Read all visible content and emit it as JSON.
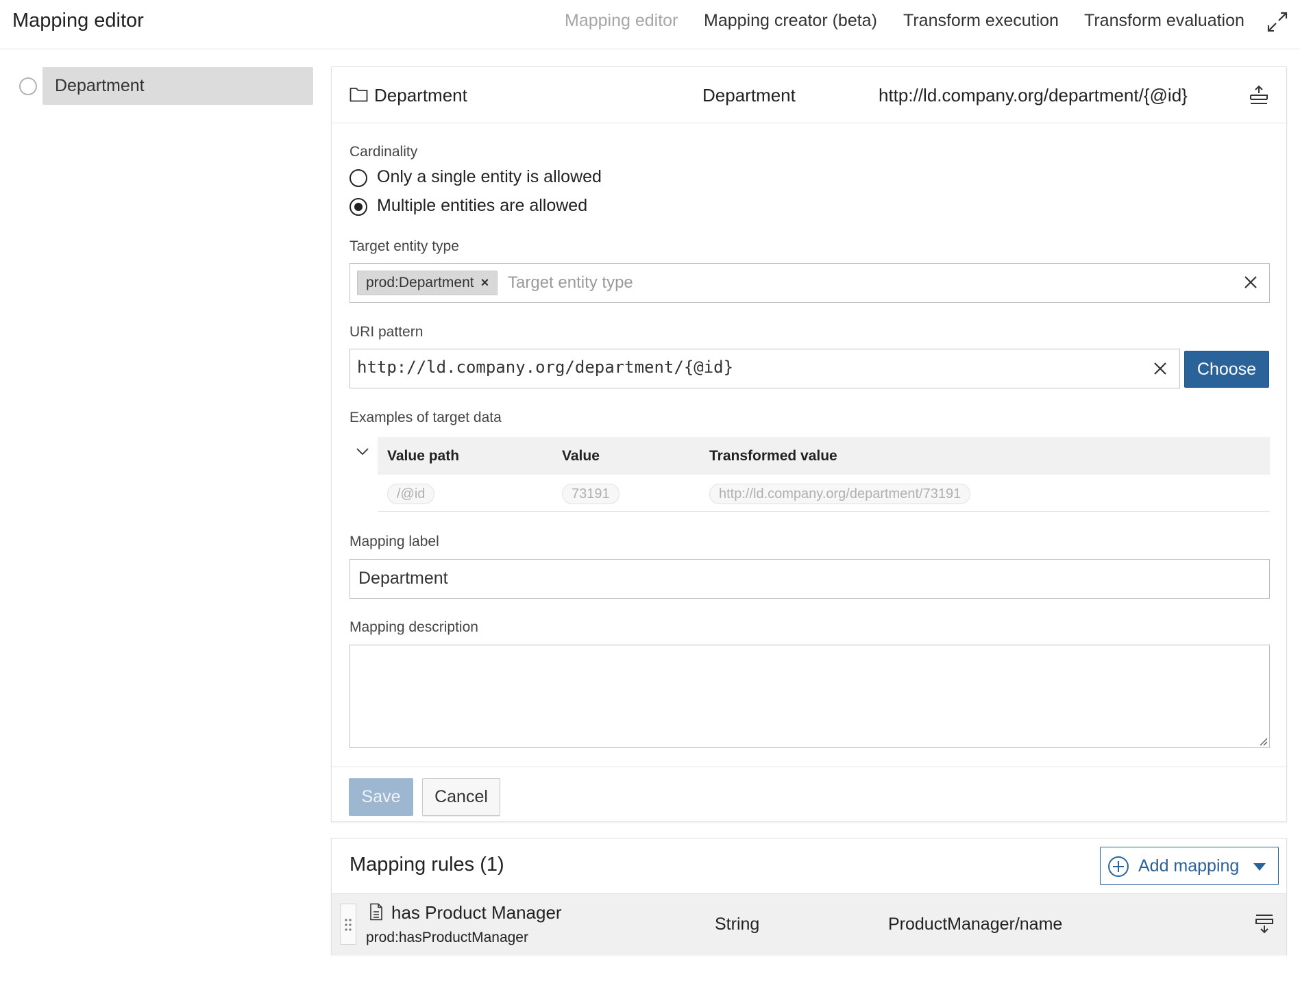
{
  "header": {
    "title": "Mapping editor",
    "tabs": [
      {
        "label": "Mapping editor",
        "active": true
      },
      {
        "label": "Mapping creator (beta)",
        "active": false
      },
      {
        "label": "Transform execution",
        "active": false
      },
      {
        "label": "Transform evaluation",
        "active": false
      }
    ]
  },
  "tree": {
    "items": [
      {
        "label": "Department"
      }
    ]
  },
  "rule_header": {
    "name": "Department",
    "type": "Department",
    "uri": "http://ld.company.org/department/{@id}"
  },
  "form": {
    "cardinality": {
      "label": "Cardinality",
      "options": [
        {
          "label": "Only a single entity is allowed",
          "selected": false
        },
        {
          "label": "Multiple entities are allowed",
          "selected": true
        }
      ]
    },
    "target_type": {
      "label": "Target entity type",
      "chips": [
        "prod:Department"
      ],
      "placeholder": "Target entity type"
    },
    "uri_pattern": {
      "label": "URI pattern",
      "value": "http://ld.company.org/department/{@id}",
      "choose_label": "Choose"
    },
    "examples": {
      "label": "Examples of target data",
      "columns": [
        "Value path",
        "Value",
        "Transformed value"
      ],
      "rows": [
        {
          "path": "/@id",
          "value": "73191",
          "transformed": "http://ld.company.org/department/73191"
        }
      ]
    },
    "mapping_label": {
      "label": "Mapping label",
      "value": "Department"
    },
    "mapping_description": {
      "label": "Mapping description",
      "value": ""
    },
    "save_label": "Save",
    "cancel_label": "Cancel"
  },
  "rules": {
    "title": "Mapping rules (1)",
    "add_label": "Add mapping",
    "items": [
      {
        "label": "has Product Manager",
        "property": "prod:hasProductManager",
        "type": "String",
        "source": "ProductManager/name"
      }
    ]
  },
  "colors": {
    "primary": "#2a6399",
    "primary_disabled": "#9db7d1",
    "selected_bg": "#dcdcdc",
    "table_head_bg": "#f1f1f1"
  },
  "icons": [
    "expand-icon",
    "folder-icon",
    "collapse-icon",
    "close-icon",
    "chevron-down-icon",
    "plus-circle-icon",
    "caret-down-icon",
    "file-icon",
    "drag-icon",
    "expand-rule-icon"
  ]
}
